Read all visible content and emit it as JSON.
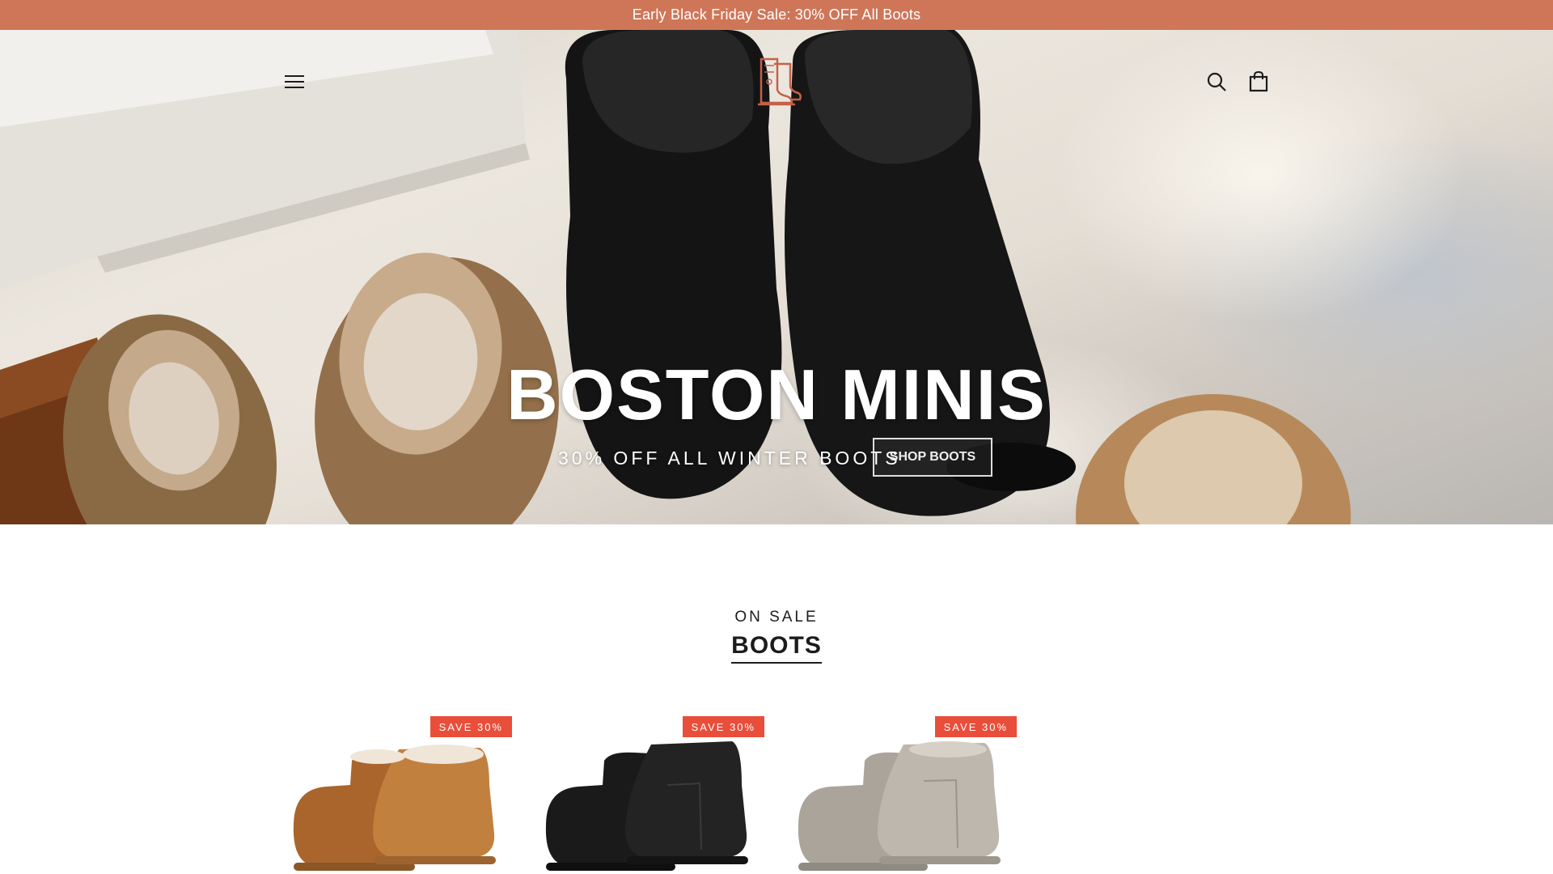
{
  "announcement": {
    "text": "Early Black Friday Sale: 30% OFF All Boots"
  },
  "header": {
    "menu_icon": "hamburger-menu-icon",
    "logo_icon": "boot-logo-icon",
    "search_icon": "search-icon",
    "cart_icon": "shopping-bag-icon"
  },
  "hero": {
    "title": "BOSTON MINIS",
    "subtitle": "30% OFF ALL WINTER BOOTS",
    "button_label": "SHOP BOOTS"
  },
  "sale_section": {
    "kicker": "ON SALE",
    "heading": "BOOTS"
  },
  "products": [
    {
      "badge": "SAVE 30%",
      "color_name": "chestnut",
      "color": "#b9773a"
    },
    {
      "badge": "SAVE 30%",
      "color_name": "black",
      "color": "#1d1d1d"
    },
    {
      "badge": "SAVE 30%",
      "color_name": "grey",
      "color": "#b9b3aa"
    }
  ],
  "colors": {
    "announcement_bg": "#cf7659",
    "badge_bg": "#e94e3a",
    "text": "#1c1c1c"
  }
}
